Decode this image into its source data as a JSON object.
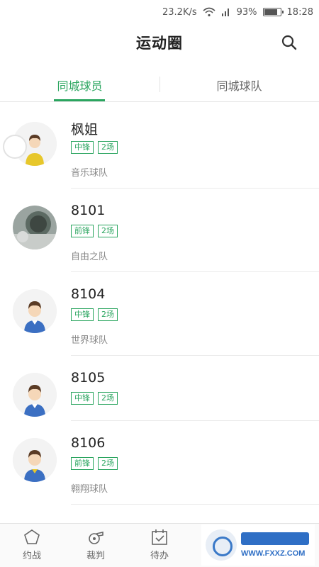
{
  "status_bar": {
    "speed": "23.2K/s",
    "battery": "93%",
    "time": "18:28"
  },
  "header": {
    "title": "运动圈"
  },
  "tabs": [
    {
      "label": "同城球员",
      "active": true
    },
    {
      "label": "同城球队",
      "active": false
    }
  ],
  "players": [
    {
      "name": "枫姐",
      "position": "中锋",
      "matches": "2场",
      "team": "音乐球队"
    },
    {
      "name": "8101",
      "position": "前锋",
      "matches": "2场",
      "team": "自由之队"
    },
    {
      "name": "8104",
      "position": "中锋",
      "matches": "2场",
      "team": "世界球队"
    },
    {
      "name": "8105",
      "position": "中锋",
      "matches": "2场",
      "team": ""
    },
    {
      "name": "8106",
      "position": "前锋",
      "matches": "2场",
      "team": "翱翔球队"
    }
  ],
  "bottom_nav": [
    {
      "label": "约战",
      "icon": "pentagon-icon"
    },
    {
      "label": "裁判",
      "icon": "whistle-icon"
    },
    {
      "label": "待办",
      "icon": "calendar-check-icon"
    }
  ],
  "watermark": {
    "site": "WWW.FXXZ.COM"
  },
  "colors": {
    "accent": "#2aa55f",
    "text": "#222222",
    "muted": "#888888"
  }
}
